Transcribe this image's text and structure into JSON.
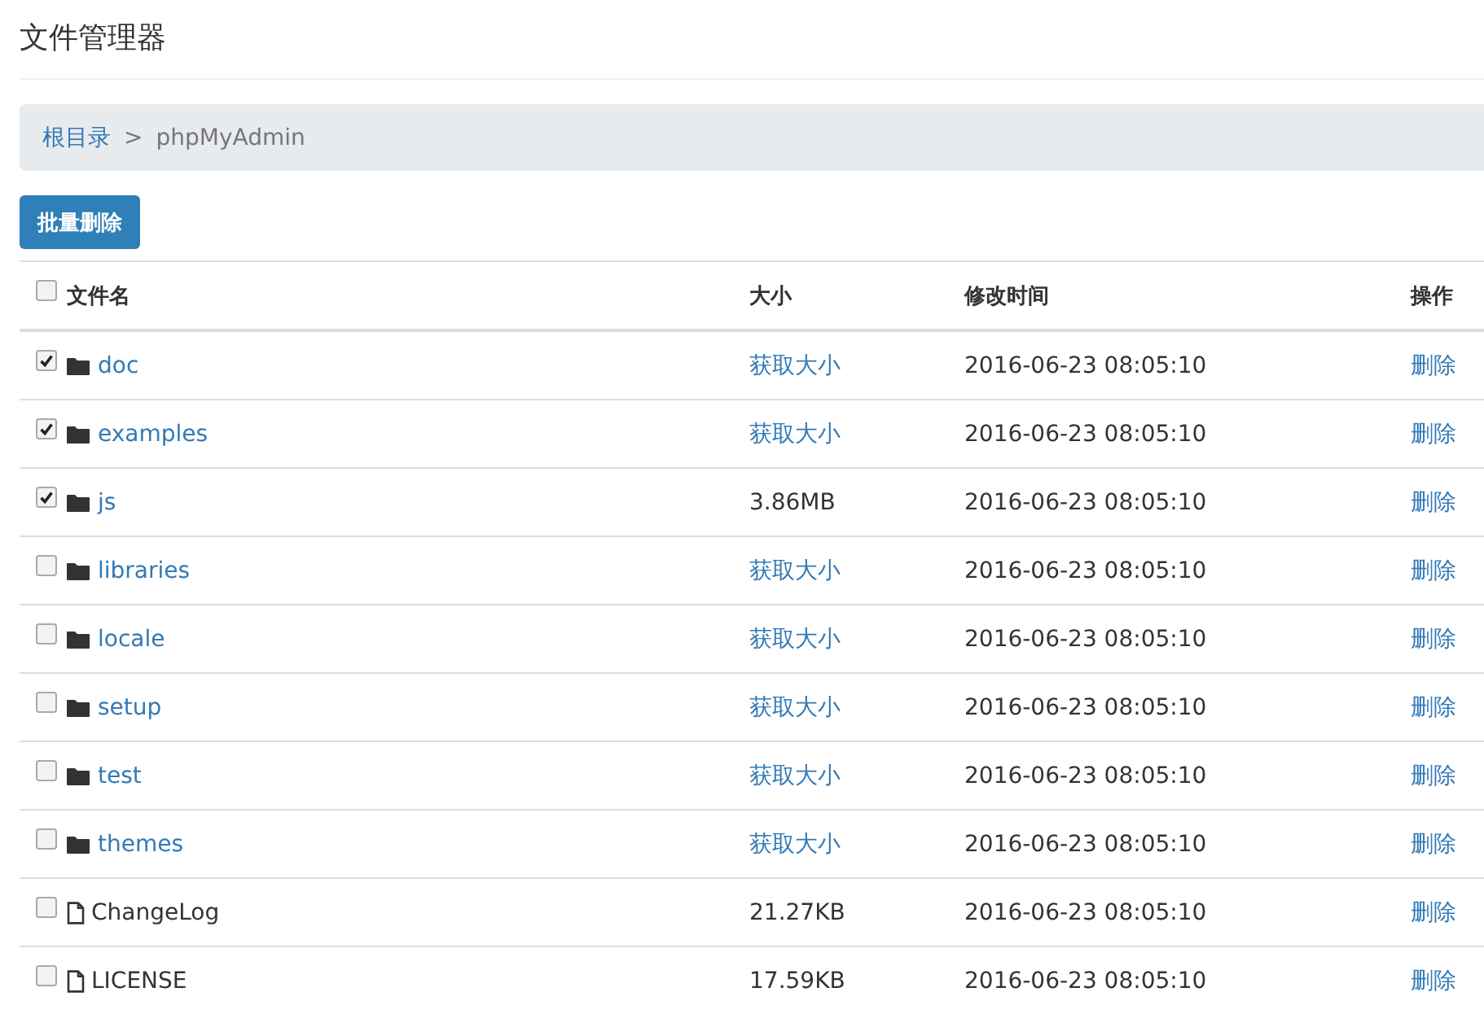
{
  "title": "文件管理器",
  "breadcrumb": [
    {
      "label": "根目录",
      "link": true
    },
    {
      "label": ">",
      "link": false
    },
    {
      "label": "phpMyAdmin",
      "link": false
    }
  ],
  "bulk_button": "批量删除",
  "table": {
    "columns": [
      "文件名",
      "大小",
      "修改时间",
      "操作"
    ],
    "select_all": false,
    "rows": [
      {
        "kind": "folder",
        "name": "doc",
        "size": "获取大小",
        "size_link": true,
        "modified": "2016-06-23 08:05:10",
        "action": "删除",
        "checked": true
      },
      {
        "kind": "folder",
        "name": "examples",
        "size": "获取大小",
        "size_link": true,
        "modified": "2016-06-23 08:05:10",
        "action": "删除",
        "checked": true
      },
      {
        "kind": "folder",
        "name": "js",
        "size": "3.86MB",
        "size_link": false,
        "modified": "2016-06-23 08:05:10",
        "action": "删除",
        "checked": true
      },
      {
        "kind": "folder",
        "name": "libraries",
        "size": "获取大小",
        "size_link": true,
        "modified": "2016-06-23 08:05:10",
        "action": "删除",
        "checked": false
      },
      {
        "kind": "folder",
        "name": "locale",
        "size": "获取大小",
        "size_link": true,
        "modified": "2016-06-23 08:05:10",
        "action": "删除",
        "checked": false
      },
      {
        "kind": "folder",
        "name": "setup",
        "size": "获取大小",
        "size_link": true,
        "modified": "2016-06-23 08:05:10",
        "action": "删除",
        "checked": false
      },
      {
        "kind": "folder",
        "name": "test",
        "size": "获取大小",
        "size_link": true,
        "modified": "2016-06-23 08:05:10",
        "action": "删除",
        "checked": false
      },
      {
        "kind": "folder",
        "name": "themes",
        "size": "获取大小",
        "size_link": true,
        "modified": "2016-06-23 08:05:10",
        "action": "删除",
        "checked": false
      },
      {
        "kind": "file",
        "name": "ChangeLog",
        "size": "21.27KB",
        "size_link": false,
        "modified": "2016-06-23 08:05:10",
        "action": "删除",
        "checked": false
      },
      {
        "kind": "file",
        "name": "LICENSE",
        "size": "17.59KB",
        "size_link": false,
        "modified": "2016-06-23 08:05:10",
        "action": "删除",
        "checked": false
      }
    ]
  }
}
